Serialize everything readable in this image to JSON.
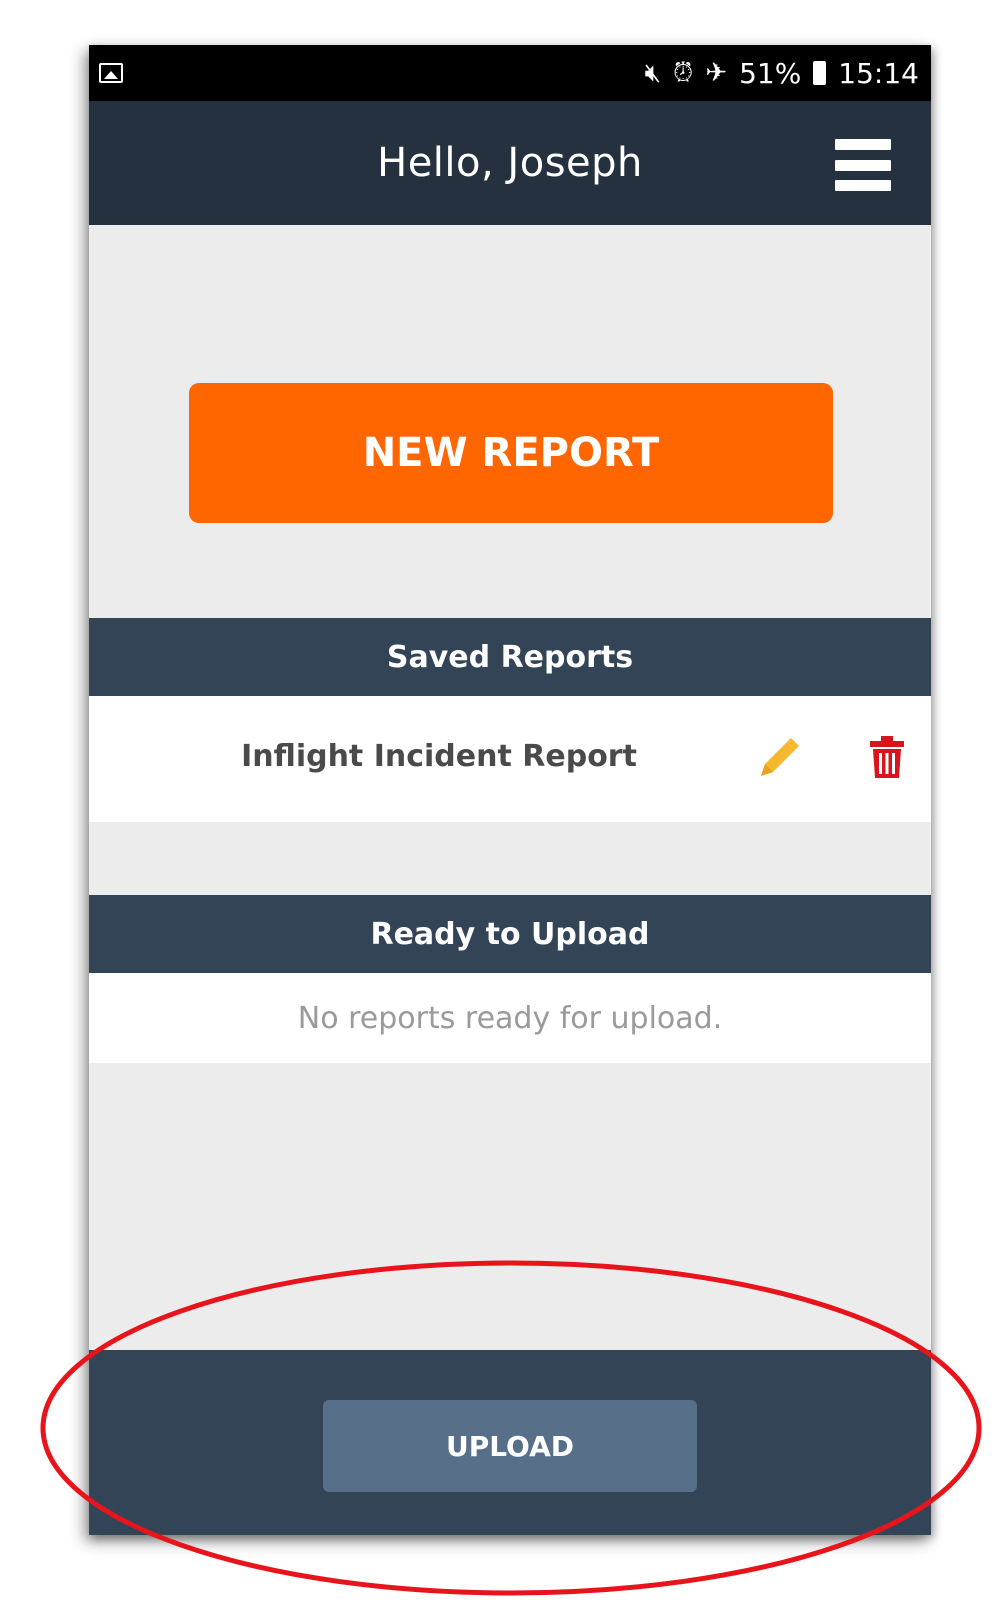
{
  "status_bar": {
    "battery": "51%",
    "time": "15:14",
    "icons": [
      "gallery-icon",
      "mute-icon",
      "alarm-icon",
      "airplane-icon",
      "battery-icon"
    ]
  },
  "header": {
    "title": "Hello, Joseph",
    "menu_icon": "hamburger-menu-icon"
  },
  "new_report_button": {
    "label": "NEW REPORT",
    "color": "#ff6600"
  },
  "saved_reports": {
    "heading": "Saved Reports",
    "items": [
      {
        "label": "Inflight Incident Report",
        "edit_icon": "pencil-icon",
        "delete_icon": "trash-icon"
      }
    ]
  },
  "ready_to_upload": {
    "heading": "Ready to Upload",
    "empty_message": "No reports ready for upload."
  },
  "footer": {
    "upload_label": "UPLOAD"
  },
  "colors": {
    "header_bg": "#26313f",
    "section_bg": "#344457",
    "upload_button_bg": "#576f89",
    "edit_icon": "#f5b82e",
    "delete_icon": "#d9141c",
    "annotation_ellipse": "#e8141c"
  }
}
